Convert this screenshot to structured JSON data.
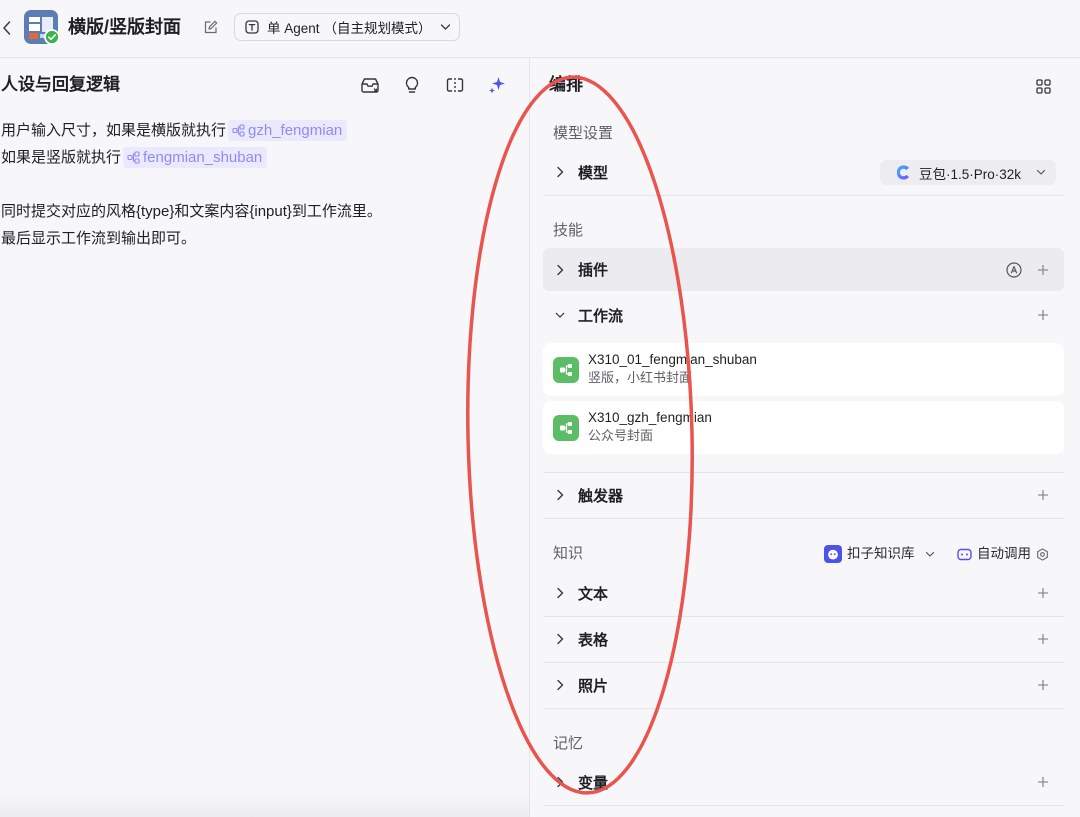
{
  "colors": {
    "text_primary": "#1f1f25",
    "text_secondary": "#5f5f69",
    "chip_bg": "#ebe9ff",
    "chip_text": "#908bf3",
    "accent": "#4d53e8",
    "workflow_icon": "#5cbd66",
    "success": "#3bb54a",
    "annotation": "#e9544f"
  },
  "header": {
    "title": "横版/竖版封面",
    "mode": {
      "label": "单 Agent",
      "detail": "（自主规划模式）"
    },
    "icons": {
      "back": "chevron-left-icon",
      "app": "app-icon",
      "status": "check-badge-icon",
      "edit": "edit-icon",
      "mode": "agent-mode-icon",
      "dropdown": "chevron-down-icon"
    }
  },
  "persona": {
    "title": "人设与回复逻辑",
    "toolbar_icons": [
      "prompt-library-icon",
      "lightbulb-icon",
      "compare-icon",
      "ai-optimize-icon"
    ],
    "lines": [
      {
        "text": "用户输入尺寸，如果是横版就执行",
        "workflow_ref": "gzh_fengmian"
      },
      {
        "text": "如果是竖版就执行",
        "workflow_ref": "fengmian_shuban"
      },
      {
        "text": "同时提交对应的风格{type}和文案内容{input}到工作流里。"
      },
      {
        "text": "最后显示工作流到输出即可。"
      }
    ]
  },
  "arrange": {
    "title": "编排",
    "layout_icon": "grid-icon",
    "model_settings": {
      "label": "模型设置",
      "row": "模型",
      "model_name": "豆包·1.5·Pro·32k",
      "model_icon": "doubao-icon"
    },
    "skills": {
      "label": "技能",
      "plugins": "插件",
      "plugins_icon": "auto-plugin-icon",
      "workflows_label": "工作流",
      "workflows": [
        {
          "name": "X310_01_fengmian_shuban",
          "description": "竖版，小红书封面"
        },
        {
          "name": "X310_gzh_fengmian",
          "description": "公众号封面"
        }
      ],
      "triggers": "触发器"
    },
    "knowledge": {
      "label": "知识",
      "source": "扣子知识库",
      "call_mode": "自动调用",
      "rows": [
        "文本",
        "表格",
        "照片"
      ]
    },
    "memory": {
      "label": "记忆",
      "rows": [
        "变量"
      ]
    }
  }
}
